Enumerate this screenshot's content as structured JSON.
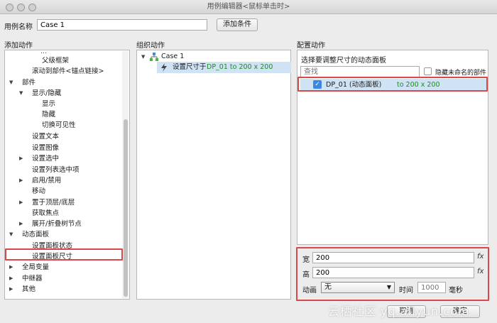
{
  "window": {
    "title": "用例编辑器<鼠标单击时>"
  },
  "case_name": {
    "label": "用例名称",
    "value": "Case 1",
    "add_condition": "添加条件"
  },
  "panels": {
    "add_action": "添加动作",
    "organize_action": "组织动作",
    "config_action": "配置动作"
  },
  "tree": {
    "cut_top": "...",
    "parent_frame": "父级框架",
    "scroll_to": "滚动到部件<锚点链接>",
    "widgets": "部件",
    "show_hide": "显示/隐藏",
    "show": "显示",
    "hide": "隐藏",
    "toggle": "切换可见性",
    "set_text": "设置文本",
    "set_image": "设置图像",
    "set_selected": "设置选中",
    "set_list_selected": "设置列表选中项",
    "enable_disable": "启用/禁用",
    "move": "移动",
    "bring_front": "置于顶层/底层",
    "focus": "获取焦点",
    "expand_tree": "展开/折叠树节点",
    "dynamic_panel": "动态面板",
    "set_panel_state": "设置面板状态",
    "set_panel_size": "设置面板尺寸",
    "global_var": "全局变量",
    "repeater": "中继器",
    "other": "其他"
  },
  "organize": {
    "case": "Case 1",
    "action_prefix": "设置尺寸于",
    "action_target": "DP_01 to 200 x 200"
  },
  "config": {
    "choose_label": "选择要调整尺寸的动态面板",
    "search_placeholder": "查找",
    "hide_unnamed": "隐藏未命名的部件",
    "item_name": "DP_01 (动态面板)",
    "item_target": "to 200 x 200",
    "width_label": "宽",
    "width_value": "200",
    "height_label": "高",
    "height_value": "200",
    "fx": "fx",
    "anim_label": "动画",
    "anim_value": "无",
    "time_label": "时间",
    "time_placeholder": "1000",
    "ms": "毫秒"
  },
  "footer": {
    "cancel": "取消",
    "ok": "确定"
  },
  "watermark": "云栖社区 yq.aliyun.com",
  "colors": {
    "highlight": "#d84a4a",
    "selected": "#cfe3f5",
    "green": "#1e8a1e"
  }
}
